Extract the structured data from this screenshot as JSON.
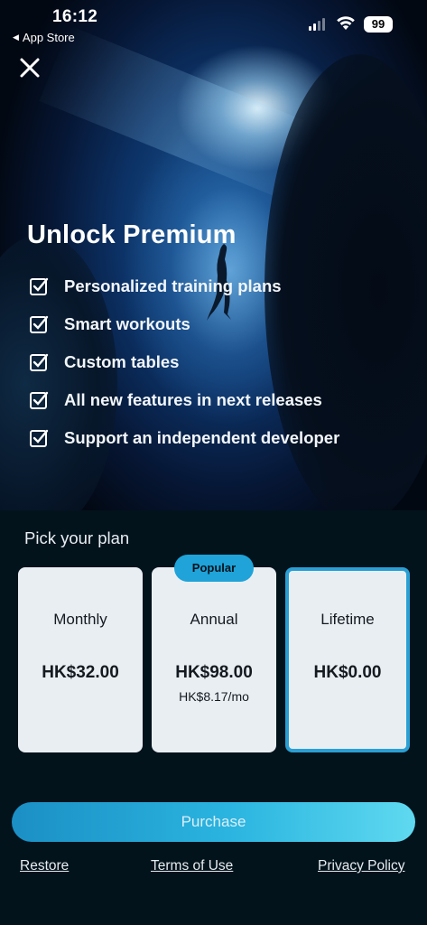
{
  "status_bar": {
    "time": "16:12",
    "back_app": "App Store",
    "battery": "99",
    "icons": [
      "cellular-signal-icon",
      "wifi-icon",
      "battery-icon"
    ]
  },
  "header": {
    "close_icon": "close-icon",
    "title": "Unlock Premium"
  },
  "features": [
    {
      "label": "Personalized training plans",
      "icon": "checkbox-checked-icon"
    },
    {
      "label": "Smart workouts",
      "icon": "checkbox-checked-icon"
    },
    {
      "label": "Custom tables",
      "icon": "checkbox-checked-icon"
    },
    {
      "label": "All new features in next releases",
      "icon": "checkbox-checked-icon"
    },
    {
      "label": "Support an independent developer",
      "icon": "checkbox-checked-icon"
    }
  ],
  "plans_section": {
    "heading": "Pick your plan",
    "plans": [
      {
        "name": "Monthly",
        "price": "HK$32.00",
        "sub": "",
        "badge": "",
        "selected": false
      },
      {
        "name": "Annual",
        "price": "HK$98.00",
        "sub": "HK$8.17/mo",
        "badge": "Popular",
        "selected": false
      },
      {
        "name": "Lifetime",
        "price": "HK$0.00",
        "sub": "",
        "badge": "",
        "selected": true
      }
    ]
  },
  "actions": {
    "purchase_label": "Purchase",
    "restore_label": "Restore",
    "terms_label": "Terms of Use",
    "privacy_label": "Privacy Policy"
  },
  "colors": {
    "accent": "#2a9fd4",
    "panel_bg": "#03131c",
    "card_bg": "#e9eef3",
    "purchase_gradient_start": "#1b8fc4",
    "purchase_gradient_end": "#5fd9f0"
  }
}
